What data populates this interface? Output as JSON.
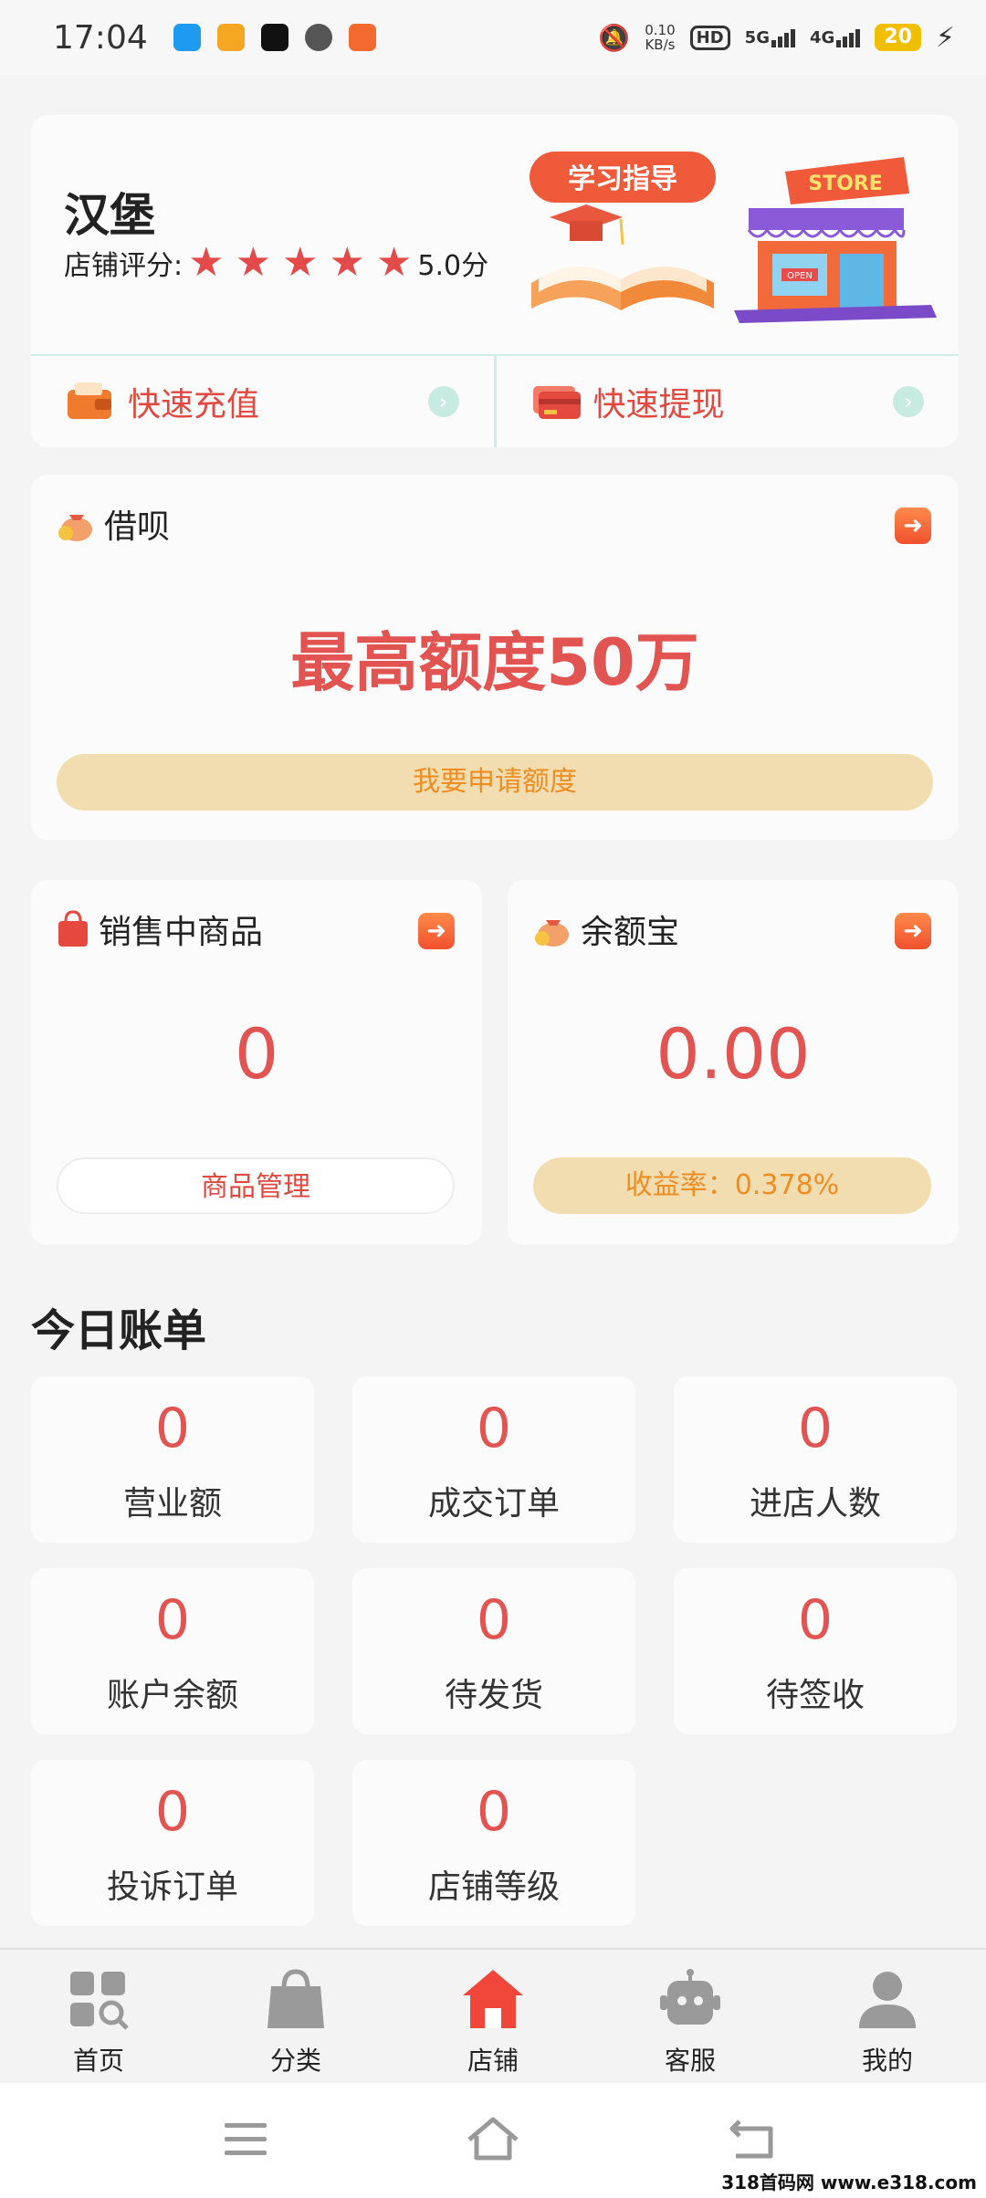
{
  "status_bar": {
    "time": "17:04",
    "net_speed": "0.10",
    "net_unit": "KB/s",
    "hd": "HD",
    "sig1": "5G",
    "sig2": "4G",
    "battery": "20"
  },
  "store": {
    "name": "汉堡",
    "rating_label": "店铺评分:",
    "rating_value": "5.0分",
    "study_badge": "学习指导",
    "store_sign": "STORE",
    "open_sign": "OPEN",
    "quick_recharge": "快速充值",
    "quick_withdraw": "快速提现"
  },
  "loan": {
    "title": "借呗",
    "amount": "最高额度50万",
    "apply_button": "我要申请额度"
  },
  "products": {
    "title": "销售中商品",
    "count": "0",
    "manage_button": "商品管理"
  },
  "yuebao": {
    "title": "余额宝",
    "amount": "0.00",
    "rate_button": "收益率：0.378%"
  },
  "today_bill": {
    "title": "今日账单",
    "stats": [
      {
        "value": "0",
        "label": "营业额"
      },
      {
        "value": "0",
        "label": "成交订单"
      },
      {
        "value": "0",
        "label": "进店人数"
      },
      {
        "value": "0",
        "label": "账户余额"
      },
      {
        "value": "0",
        "label": "待发货"
      },
      {
        "value": "0",
        "label": "待签收"
      },
      {
        "value": "0",
        "label": "投诉订单"
      },
      {
        "value": "0",
        "label": "店铺等级"
      }
    ]
  },
  "bottom_nav": [
    {
      "label": "首页",
      "icon": "home-grid-icon",
      "active": false
    },
    {
      "label": "分类",
      "icon": "shopping-bag-icon",
      "active": false
    },
    {
      "label": "店铺",
      "icon": "store-icon",
      "active": true
    },
    {
      "label": "客服",
      "icon": "robot-icon",
      "active": false
    },
    {
      "label": "我的",
      "icon": "user-icon",
      "active": false
    }
  ],
  "colors": {
    "accent_red": "#e25452",
    "accent_orange": "#ee8d22",
    "pill_bg": "#f2ddb0",
    "nav_active": "#f0473a",
    "nav_inactive": "#9a9a9a"
  },
  "watermark": "318首码网 www.e318.com"
}
